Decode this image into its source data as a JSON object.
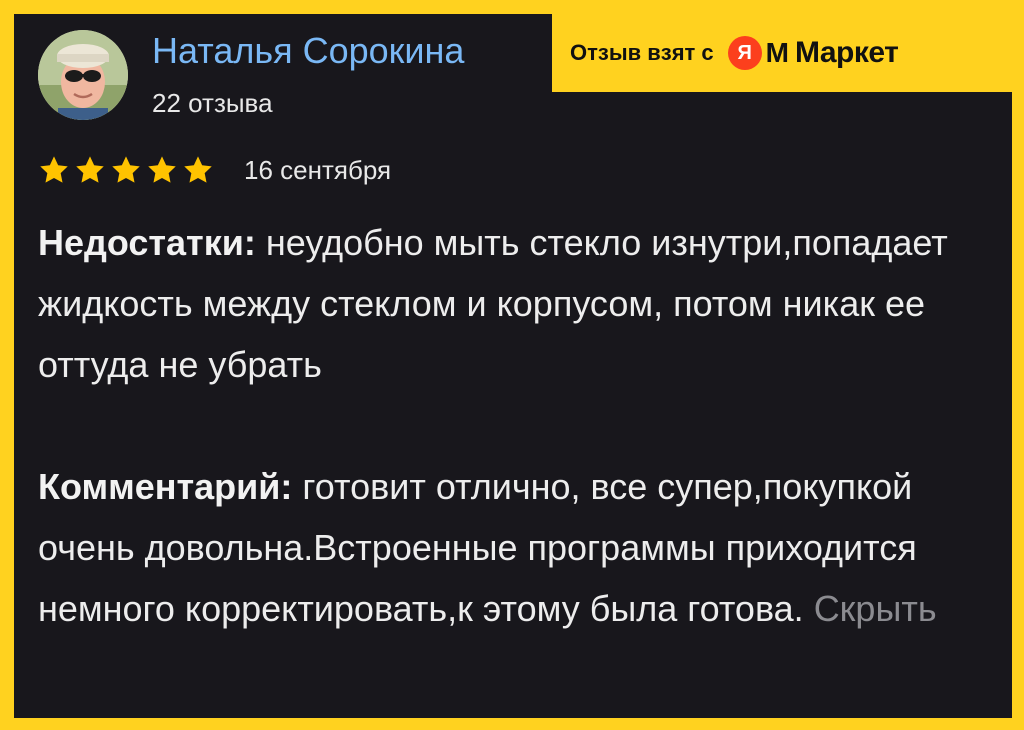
{
  "badge": {
    "text": "Отзыв взят с",
    "logo_letter": "Я",
    "logo_mark": "M",
    "logo_word": "Маркет"
  },
  "author": {
    "name": "Наталья Сорокина",
    "reviews": "22 отзыва"
  },
  "rating": {
    "stars": 5,
    "max": 5,
    "star_color": "#ffc300",
    "date": "16 сентября"
  },
  "review": {
    "cons_label": "Недостатки:",
    "cons_text": " неудобно мыть стекло изнутри,попадает жидкость между стеклом и корпусом, потом никак ее оттуда не убрать",
    "comment_label": "Комментарий:",
    "comment_text": " готовит отлично, все супер,покупкой очень довольна.Встроенные программы приходится немного корректировать,к этому была готова. ",
    "hide_link": "Скрыть"
  },
  "colors": {
    "frame": "#ffd21f",
    "card": "#18171c",
    "name": "#7ab8f5",
    "yandex_red": "#fc3f1d"
  }
}
